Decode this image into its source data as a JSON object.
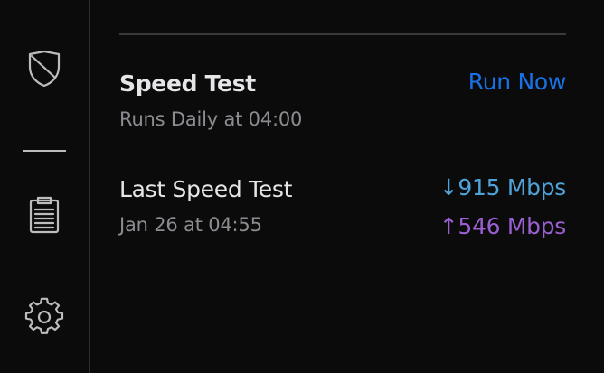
{
  "colors": {
    "accent_blue": "#1a72e8",
    "download": "#4fa3d9",
    "upload": "#9a5fd0",
    "background": "#0b0b0c"
  },
  "sidebar": {
    "items": [
      {
        "icon": "shield-icon"
      },
      {
        "icon": "clipboard-list-icon"
      },
      {
        "icon": "gear-icon"
      }
    ]
  },
  "speed_test": {
    "title": "Speed Test",
    "schedule": "Runs Daily at 04:00",
    "run_now_label": "Run Now"
  },
  "last_speed_test": {
    "title": "Last Speed Test",
    "timestamp": "Jan 26 at 04:55",
    "download": "↓915 Mbps",
    "upload": "↑546 Mbps"
  }
}
